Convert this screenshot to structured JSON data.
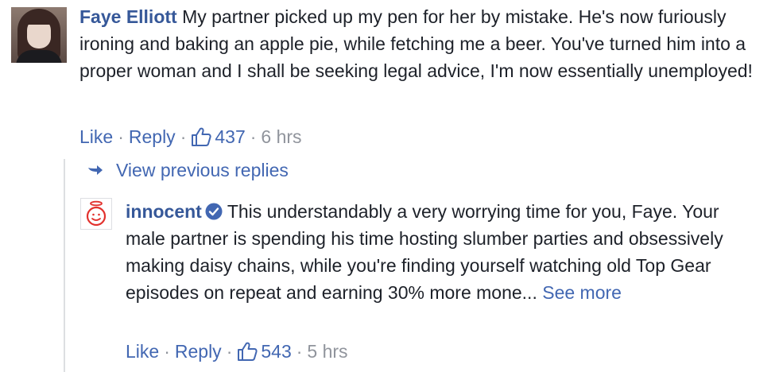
{
  "main_comment": {
    "author": "Faye Elliott",
    "text": "My partner picked up my pen for her by mistake. He's now furiously ironing and baking an apple pie, while fetching me a beer. You've turned him into a proper woman and I shall be seeking legal advice, I'm now essentially unemployed!",
    "like_label": "Like",
    "reply_label": "Reply",
    "separator": "·",
    "like_count": "437",
    "time": "6 hrs"
  },
  "view_previous_replies": "View previous replies",
  "reply": {
    "author": "innocent",
    "verified": true,
    "text": "This understandably a very worrying time for you, Faye. Your male partner is spending his time hosting slumber parties and obsessively making daisy chains, while you're finding yourself watching old Top Gear episodes on repeat and earning 30% more mone...",
    "see_more_label": "See more",
    "like_label": "Like",
    "reply_label": "Reply",
    "separator": "·",
    "like_count": "543",
    "time": "5 hrs"
  },
  "icons": {
    "like": "thumbs-up-icon",
    "reply_arrow": "reply-arrow-icon",
    "verified": "verified-badge-icon"
  },
  "colors": {
    "link_blue": "#4267b2",
    "author_blue": "#365899",
    "meta_gray": "#90949c",
    "text": "#1d2129",
    "brand_red": "#e2312d"
  }
}
